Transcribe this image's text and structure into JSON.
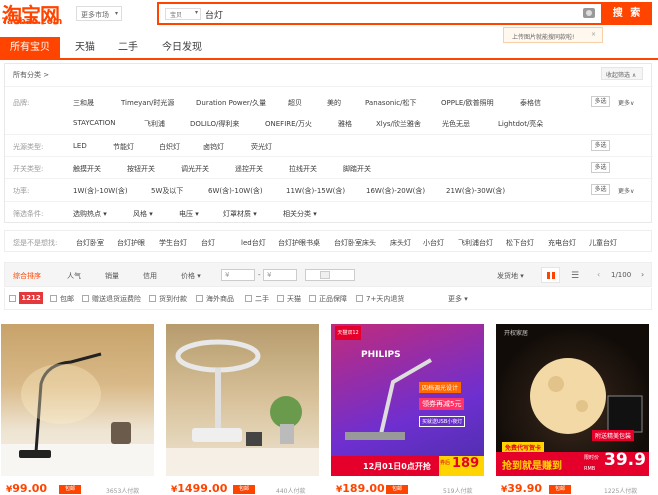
{
  "logo": {
    "cn": "淘宝网",
    "en": "Taobao.com"
  },
  "market": {
    "label": "更多市场"
  },
  "search": {
    "category": "宝贝",
    "query": "台灯",
    "button": "搜 索"
  },
  "tip": {
    "text": "上传图片就能搜同款啦!",
    "close": "×"
  },
  "tabs": [
    "所有宝贝",
    "天猫",
    "二手",
    "今日发现"
  ],
  "filters": {
    "all_category": "所有分类 >",
    "fold": "收起筛选 ∧",
    "brand_label": "品牌:",
    "brands_row1": [
      "三和晟",
      "Timeyan/时光源",
      "Duration Power/久量",
      "超贝",
      "美的",
      "Panasonic/松下",
      "OPPLE/欧普照明",
      "泰格信"
    ],
    "brands_row2": [
      "STAYCATION",
      "飞利浦",
      "DOLILO/得利来",
      "ONEFIRE/万火",
      "雅格",
      "Xlys/欣兰雅舍",
      "光色无忌",
      "Lightdot/亮朵"
    ],
    "light_label": "光源类型:",
    "light_items": [
      "LED",
      "节能灯",
      "白炽灯",
      "卤钨灯",
      "荧光灯"
    ],
    "switch_label": "开关类型:",
    "switch_items": [
      "触摸开关",
      "按钮开关",
      "调光开关",
      "遥控开关",
      "拉线开关",
      "脚踏开关"
    ],
    "power_label": "功率:",
    "power_items": [
      "1W(含)-10W(含)",
      "5W及以下",
      "6W(含)-10W(含)",
      "11W(含)-15W(含)",
      "16W(含)-20W(含)",
      "21W(含)-30W(含)"
    ],
    "cond_label": "筛选条件:",
    "cond_items": [
      "选购热点 ▾",
      "风格 ▾",
      "电压 ▾",
      "灯罩材质 ▾",
      "相关分类 ▾"
    ],
    "multi": "多选",
    "more": "更多∨"
  },
  "think": {
    "label": "您是不是想找:",
    "items": [
      "台灯卧室",
      "台灯护眼",
      "学生台灯",
      "台灯",
      "led台灯",
      "台灯护眼书桌",
      "台灯卧室床头",
      "床头灯",
      "小台灯",
      "飞利浦台灯",
      "松下台灯",
      "充电台灯",
      "儿童台灯"
    ]
  },
  "sort": {
    "items": [
      "综合排序",
      "人气",
      "销量",
      "信用",
      "价格 ▾"
    ],
    "price_from": "¥",
    "price_to": "¥",
    "dash": "-",
    "ship": "发货地 ▾",
    "page": "1/100"
  },
  "checks": {
    "badge": "1212",
    "items": [
      "包邮",
      "赠送退货运费险",
      "货到付款",
      "海外商品",
      "二手",
      "天猫",
      "正品保障",
      "7+天内退货"
    ],
    "more": "更多 ▾"
  },
  "products": [
    {
      "price": "99.00",
      "count": "3653人付款"
    },
    {
      "price": "1499.00",
      "count": "440人付款"
    },
    {
      "price": "189.00",
      "count": "519人付款"
    },
    {
      "price": "39.90",
      "count": "1225人付款"
    }
  ],
  "ads": {
    "philips": "PHILIPS",
    "p1": "四档调光设计",
    "p2": "领券再减5元",
    "p3": "买就送USB小夜灯",
    "p4": "12月01日0点开抢",
    "p5": "天猫双12",
    "p6": "券后",
    "p7": "189",
    "m1": "开权家居",
    "m2": "附送精美包装",
    "m3": "免费代写贺卡",
    "m4": "抢到就是赚到",
    "m5": "限时价",
    "m6": "RMB",
    "m7": "39.9",
    "price_tag": "包邮"
  },
  "colors": {
    "brand": "#ff4400"
  }
}
